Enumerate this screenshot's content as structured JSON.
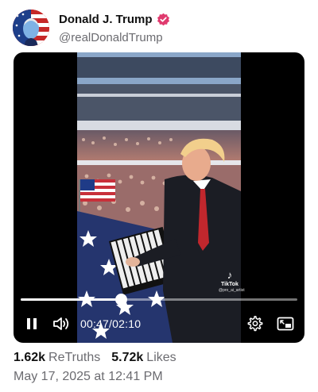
{
  "author": {
    "name": "Donald J. Trump",
    "handle": "@realDonaldTrump",
    "verified_color": "#e03a6e"
  },
  "video": {
    "current_time": "00:47",
    "duration": "02:10",
    "progress_fraction": 0.3615,
    "watermark_brand": "TikTok",
    "watermark_handle": "@pro_ai_artist"
  },
  "stats": {
    "retruths_count": "1.62k",
    "retruths_label": "ReTruths",
    "likes_count": "5.72k",
    "likes_label": "Likes"
  },
  "timestamp": "May 17, 2025 at 12:41 PM",
  "icons": {
    "avatar": "avatar-flag-portrait",
    "verified": "verified-badge-icon",
    "pause": "pause-icon",
    "volume": "volume-icon",
    "settings": "gear-icon",
    "pip": "picture-in-picture-icon"
  }
}
